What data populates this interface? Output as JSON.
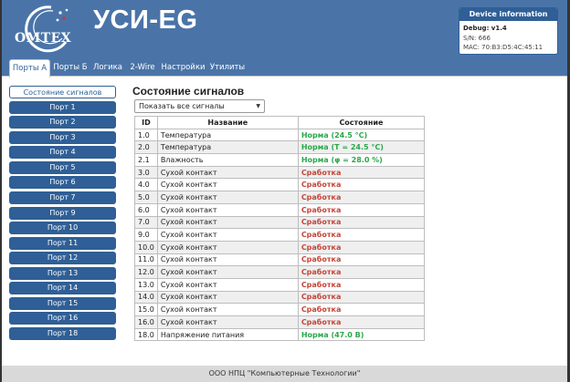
{
  "app": {
    "logo_text": "OMTEX",
    "title": "УСИ-EG"
  },
  "device_info": {
    "heading": "Device information",
    "firmware": "Debug: v1.4",
    "serial": "S/N: 666",
    "mac": "MAC: 70:B3:D5:4C:45:11"
  },
  "tabs": [
    {
      "label": "Порты А",
      "active": true
    },
    {
      "label": "Порты Б"
    },
    {
      "label": "Логика"
    },
    {
      "label": "2-Wire"
    },
    {
      "label": "Настройки"
    },
    {
      "label": "Утилиты"
    }
  ],
  "sidebar": {
    "items": [
      {
        "label": "Состояние сигналов",
        "active": true
      },
      {
        "label": "Порт 1"
      },
      {
        "label": "Порт 2"
      },
      {
        "label": "Порт 3"
      },
      {
        "label": "Порт 4"
      },
      {
        "label": "Порт 5"
      },
      {
        "label": "Порт 6"
      },
      {
        "label": "Порт 7"
      },
      {
        "label": "Порт 9"
      },
      {
        "label": "Порт 10"
      },
      {
        "label": "Порт 11"
      },
      {
        "label": "Порт 12"
      },
      {
        "label": "Порт 13"
      },
      {
        "label": "Порт 14"
      },
      {
        "label": "Порт 15"
      },
      {
        "label": "Порт 16"
      },
      {
        "label": "Порт 18"
      }
    ]
  },
  "main": {
    "title": "Состояние сигналов",
    "filter": {
      "selected": "Показать все сигналы"
    },
    "table": {
      "headers": [
        "ID",
        "Название",
        "Состояние"
      ],
      "rows": [
        {
          "id": "1.0",
          "name": "Температура",
          "state": "Норма (24.5 °C)",
          "status": "ok"
        },
        {
          "id": "2.0",
          "name": "Температура",
          "state": "Норма (T = 24.5 °C)",
          "status": "ok"
        },
        {
          "id": "2.1",
          "name": "Влажность",
          "state": "Норма (φ = 28.0 %)",
          "status": "ok"
        },
        {
          "id": "3.0",
          "name": "Сухой контакт",
          "state": "Сработка",
          "status": "alarm"
        },
        {
          "id": "4.0",
          "name": "Сухой контакт",
          "state": "Сработка",
          "status": "alarm"
        },
        {
          "id": "5.0",
          "name": "Сухой контакт",
          "state": "Сработка",
          "status": "alarm"
        },
        {
          "id": "6.0",
          "name": "Сухой контакт",
          "state": "Сработка",
          "status": "alarm"
        },
        {
          "id": "7.0",
          "name": "Сухой контакт",
          "state": "Сработка",
          "status": "alarm"
        },
        {
          "id": "9.0",
          "name": "Сухой контакт",
          "state": "Сработка",
          "status": "alarm"
        },
        {
          "id": "10.0",
          "name": "Сухой контакт",
          "state": "Сработка",
          "status": "alarm"
        },
        {
          "id": "11.0",
          "name": "Сухой контакт",
          "state": "Сработка",
          "status": "alarm"
        },
        {
          "id": "12.0",
          "name": "Сухой контакт",
          "state": "Сработка",
          "status": "alarm"
        },
        {
          "id": "13.0",
          "name": "Сухой контакт",
          "state": "Сработка",
          "status": "alarm"
        },
        {
          "id": "14.0",
          "name": "Сухой контакт",
          "state": "Сработка",
          "status": "alarm"
        },
        {
          "id": "15.0",
          "name": "Сухой контакт",
          "state": "Сработка",
          "status": "alarm"
        },
        {
          "id": "16.0",
          "name": "Сухой контакт",
          "state": "Сработка",
          "status": "alarm"
        },
        {
          "id": "18.0",
          "name": "Напряжение питания",
          "state": "Норма (47.0 В)",
          "status": "ok"
        }
      ]
    }
  },
  "footer": {
    "text": "ООО НПЦ \"Компьютерные Технологии\""
  },
  "colors": {
    "header": "#4a74a8",
    "accent": "#2f5f96",
    "ok": "#2aa84a",
    "alarm": "#c4463a",
    "footer": "#d9d9d9"
  }
}
